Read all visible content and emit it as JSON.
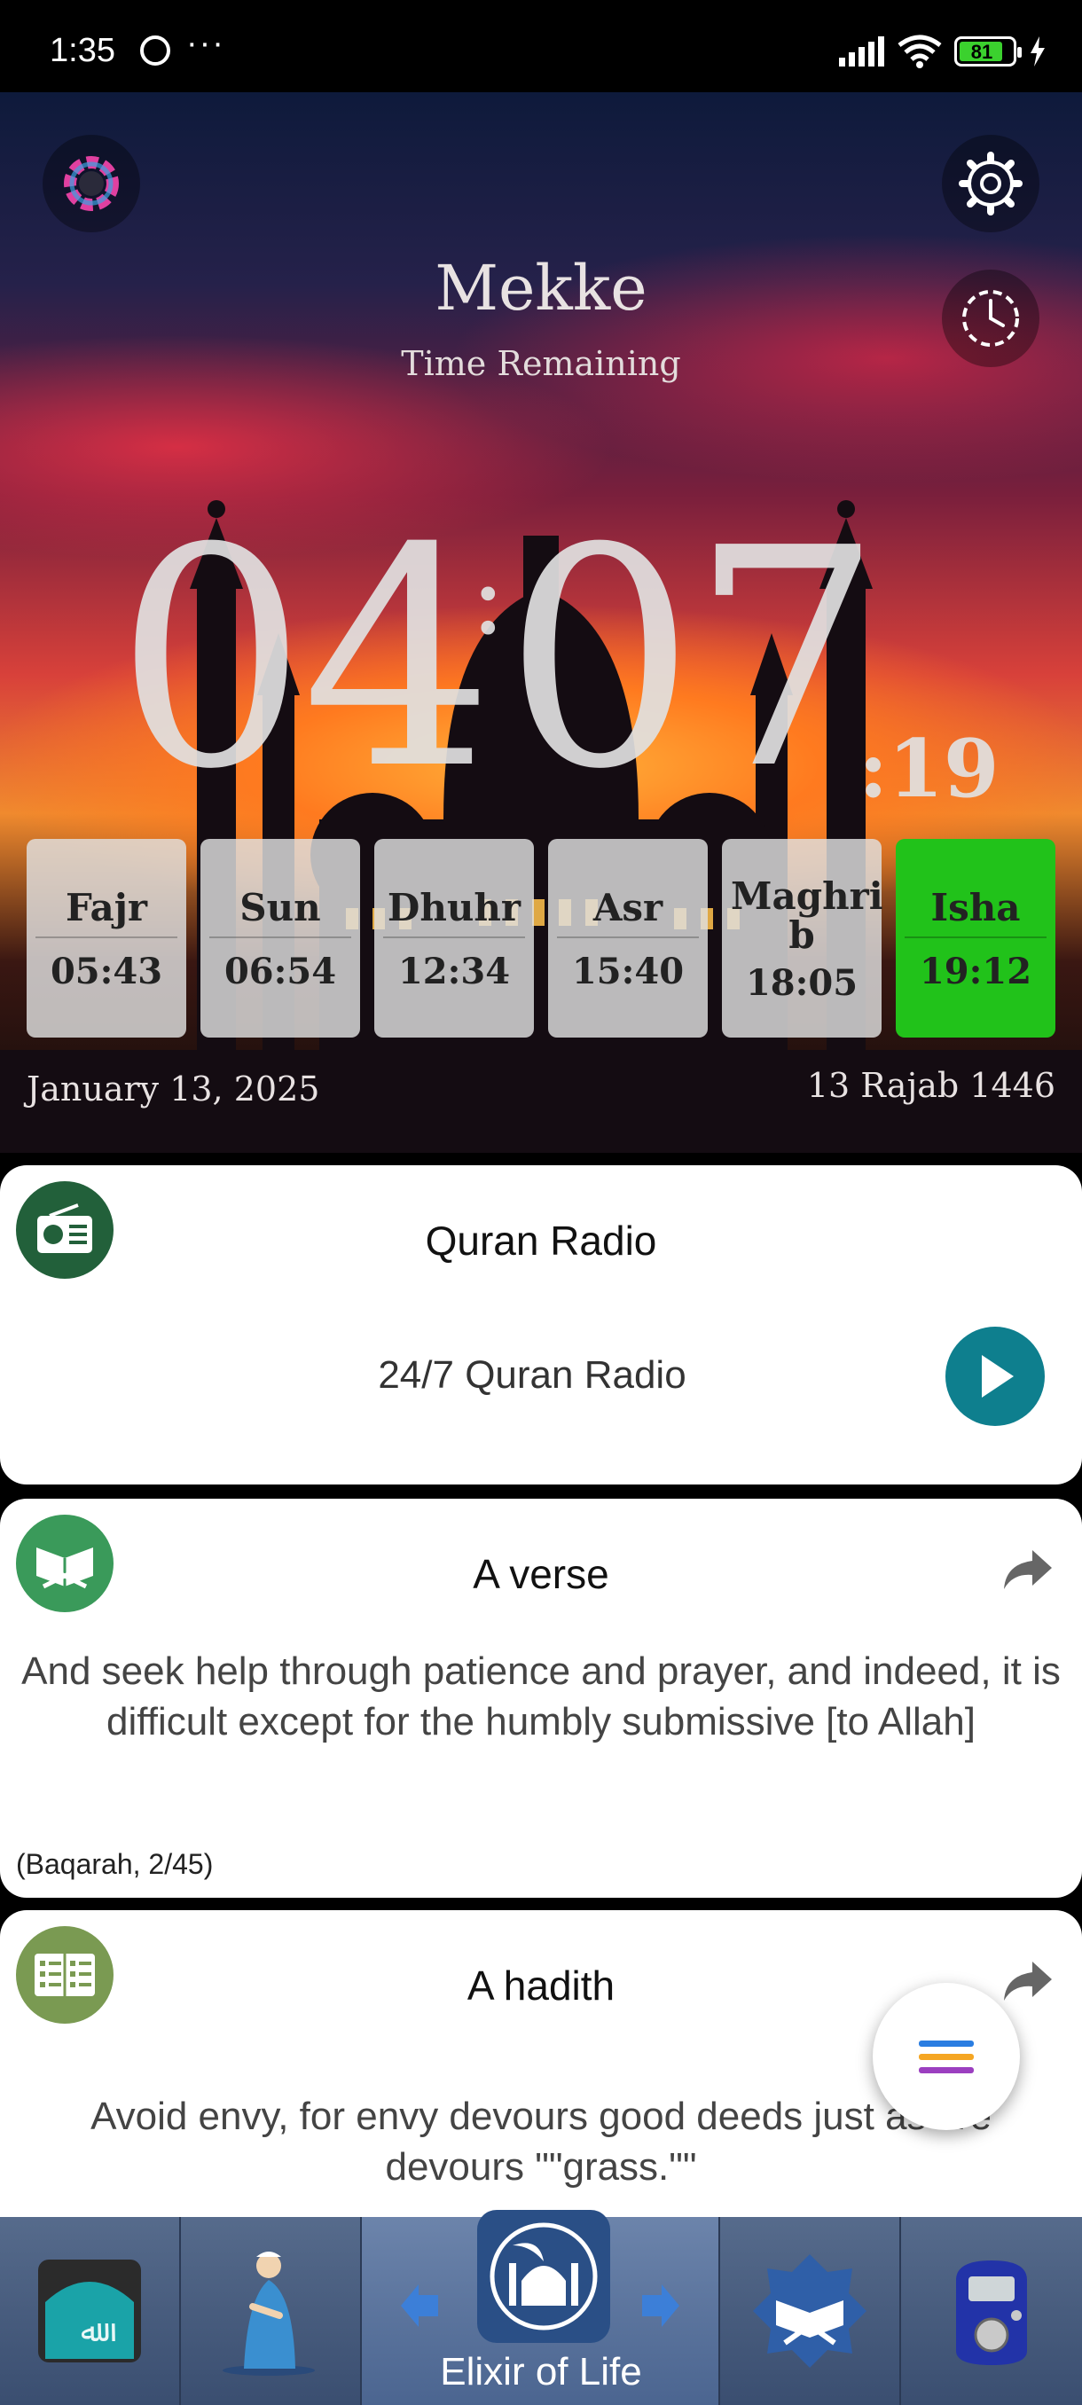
{
  "status_bar": {
    "time": "1:35",
    "dots": "···",
    "battery": "81"
  },
  "hero": {
    "city": "Mekke",
    "time_label": "Time Remaining",
    "countdown": {
      "hours": "04",
      "minutes": "07",
      "seconds": ":19"
    },
    "prayers": [
      {
        "name": "Fajr",
        "time": "05:43",
        "active": false
      },
      {
        "name": "Sun",
        "time": "06:54",
        "active": false
      },
      {
        "name": "Dhuhr",
        "time": "12:34",
        "active": false
      },
      {
        "name": "Asr",
        "time": "15:40",
        "active": false
      },
      {
        "name": "Maghri\nb",
        "time": "18:05",
        "active": false
      },
      {
        "name": "Isha",
        "time": "19:12",
        "active": true
      }
    ],
    "date_gregorian": "January 13, 2025",
    "date_hijri": "13 Rajab 1446"
  },
  "radio_card": {
    "title": "Quran Radio",
    "subtitle": "24/7 Quran Radio",
    "icon": "radio-icon"
  },
  "verse_card": {
    "title": "A verse",
    "text": "And seek help through patience and prayer, and indeed, it is difficult except for the humbly submissive [to Allah]",
    "reference": "(Baqarah, 2/45)",
    "icon": "quran-book-icon"
  },
  "hadith_card": {
    "title": "A hadith",
    "text": "Avoid envy, for envy devours good deeds just as fire devours \"\"grass.\"\"",
    "icon": "hadith-book-icon"
  },
  "fab_colors": [
    "#2a7de1",
    "#f5a623",
    "#9b3fc0"
  ],
  "bottom_nav": {
    "center_label": "Elixir of Life",
    "items": [
      "allah-name-icon",
      "praying-man-icon",
      "mosque-logo-icon",
      "quran-icon",
      "tasbih-counter-icon"
    ]
  },
  "colors": {
    "active_prayer": "#21c21a",
    "play_button": "#0e7f8e",
    "radio_icon_bg": "#22603a",
    "verse_icon_bg": "#3a9a5a",
    "hadith_icon_bg": "#7a9a52"
  }
}
